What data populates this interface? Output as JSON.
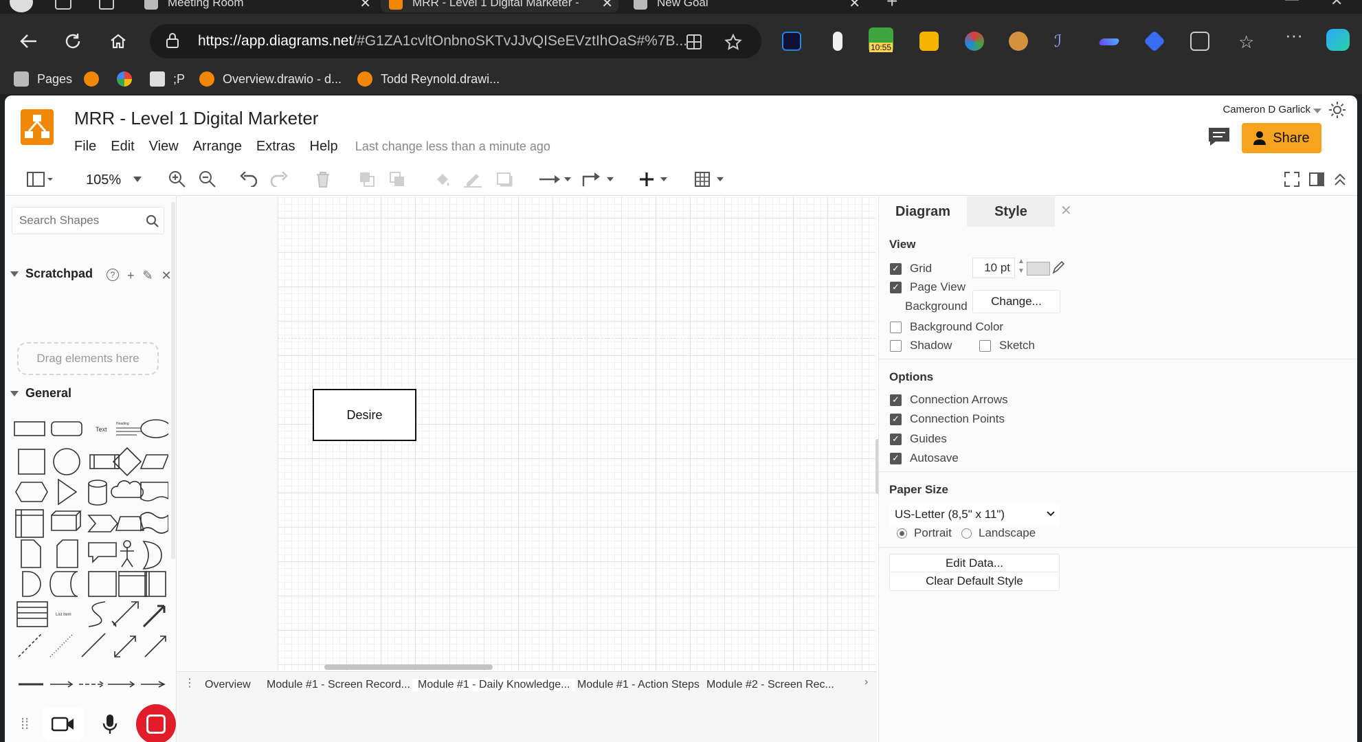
{
  "browser": {
    "tabs": [
      {
        "title": "Meeting Room",
        "active": false
      },
      {
        "title": "MRR - Level 1 Digital Marketer - ",
        "active": true
      },
      {
        "title": "New Goal",
        "active": false
      }
    ],
    "url_host": "https://app.diagrams.net",
    "url_path": "/#G1ZA1cvltOnbnoSKTvJJvQISeEVztIhOaS#%7B...",
    "extension_badge": "10:55",
    "bookmarks": [
      "Pages",
      "",
      "",
      ";P",
      "Overview.drawio - d...",
      "Todd Reynold.drawi..."
    ]
  },
  "app": {
    "title": "MRR - Level 1 Digital Marketer",
    "menu": [
      "File",
      "Edit",
      "View",
      "Arrange",
      "Extras",
      "Help"
    ],
    "last_change": "Last change less than a minute ago",
    "user": "Cameron D Garlick",
    "share_label": "Share",
    "zoom": "105%"
  },
  "left_panel": {
    "search_placeholder": "Search Shapes",
    "scratchpad_title": "Scratchpad",
    "scratchpad_drop": "Drag elements here",
    "general_title": "General",
    "shape_text_label": "Text",
    "shape_heading_label": "Heading",
    "shape_list_label": "List Item"
  },
  "canvas": {
    "shape_label": "Desire"
  },
  "page_tabs": [
    "Overview",
    "Module #1 - Screen Record...",
    "Module #1 - Daily Knowledge...",
    "Module #1 - Action Steps",
    "Module #2 - Screen Rec..."
  ],
  "right_panel": {
    "tabs": [
      "Diagram",
      "Style"
    ],
    "view_heading": "View",
    "grid_label": "Grid",
    "grid_size": "10 pt",
    "page_view_label": "Page View",
    "background_label": "Background",
    "change_button": "Change...",
    "background_color_label": "Background Color",
    "shadow_label": "Shadow",
    "sketch_label": "Sketch",
    "options_heading": "Options",
    "options": [
      "Connection Arrows",
      "Connection Points",
      "Guides",
      "Autosave"
    ],
    "paper_size_heading": "Paper Size",
    "paper_size_value": "US-Letter (8,5\" x 11\")",
    "orientation": [
      "Portrait",
      "Landscape"
    ],
    "edit_data_button": "Edit Data...",
    "clear_style_button": "Clear Default Style"
  },
  "colors": {
    "accent": "#f08705",
    "share": "#f8a31d",
    "record": "#e11d2a"
  }
}
